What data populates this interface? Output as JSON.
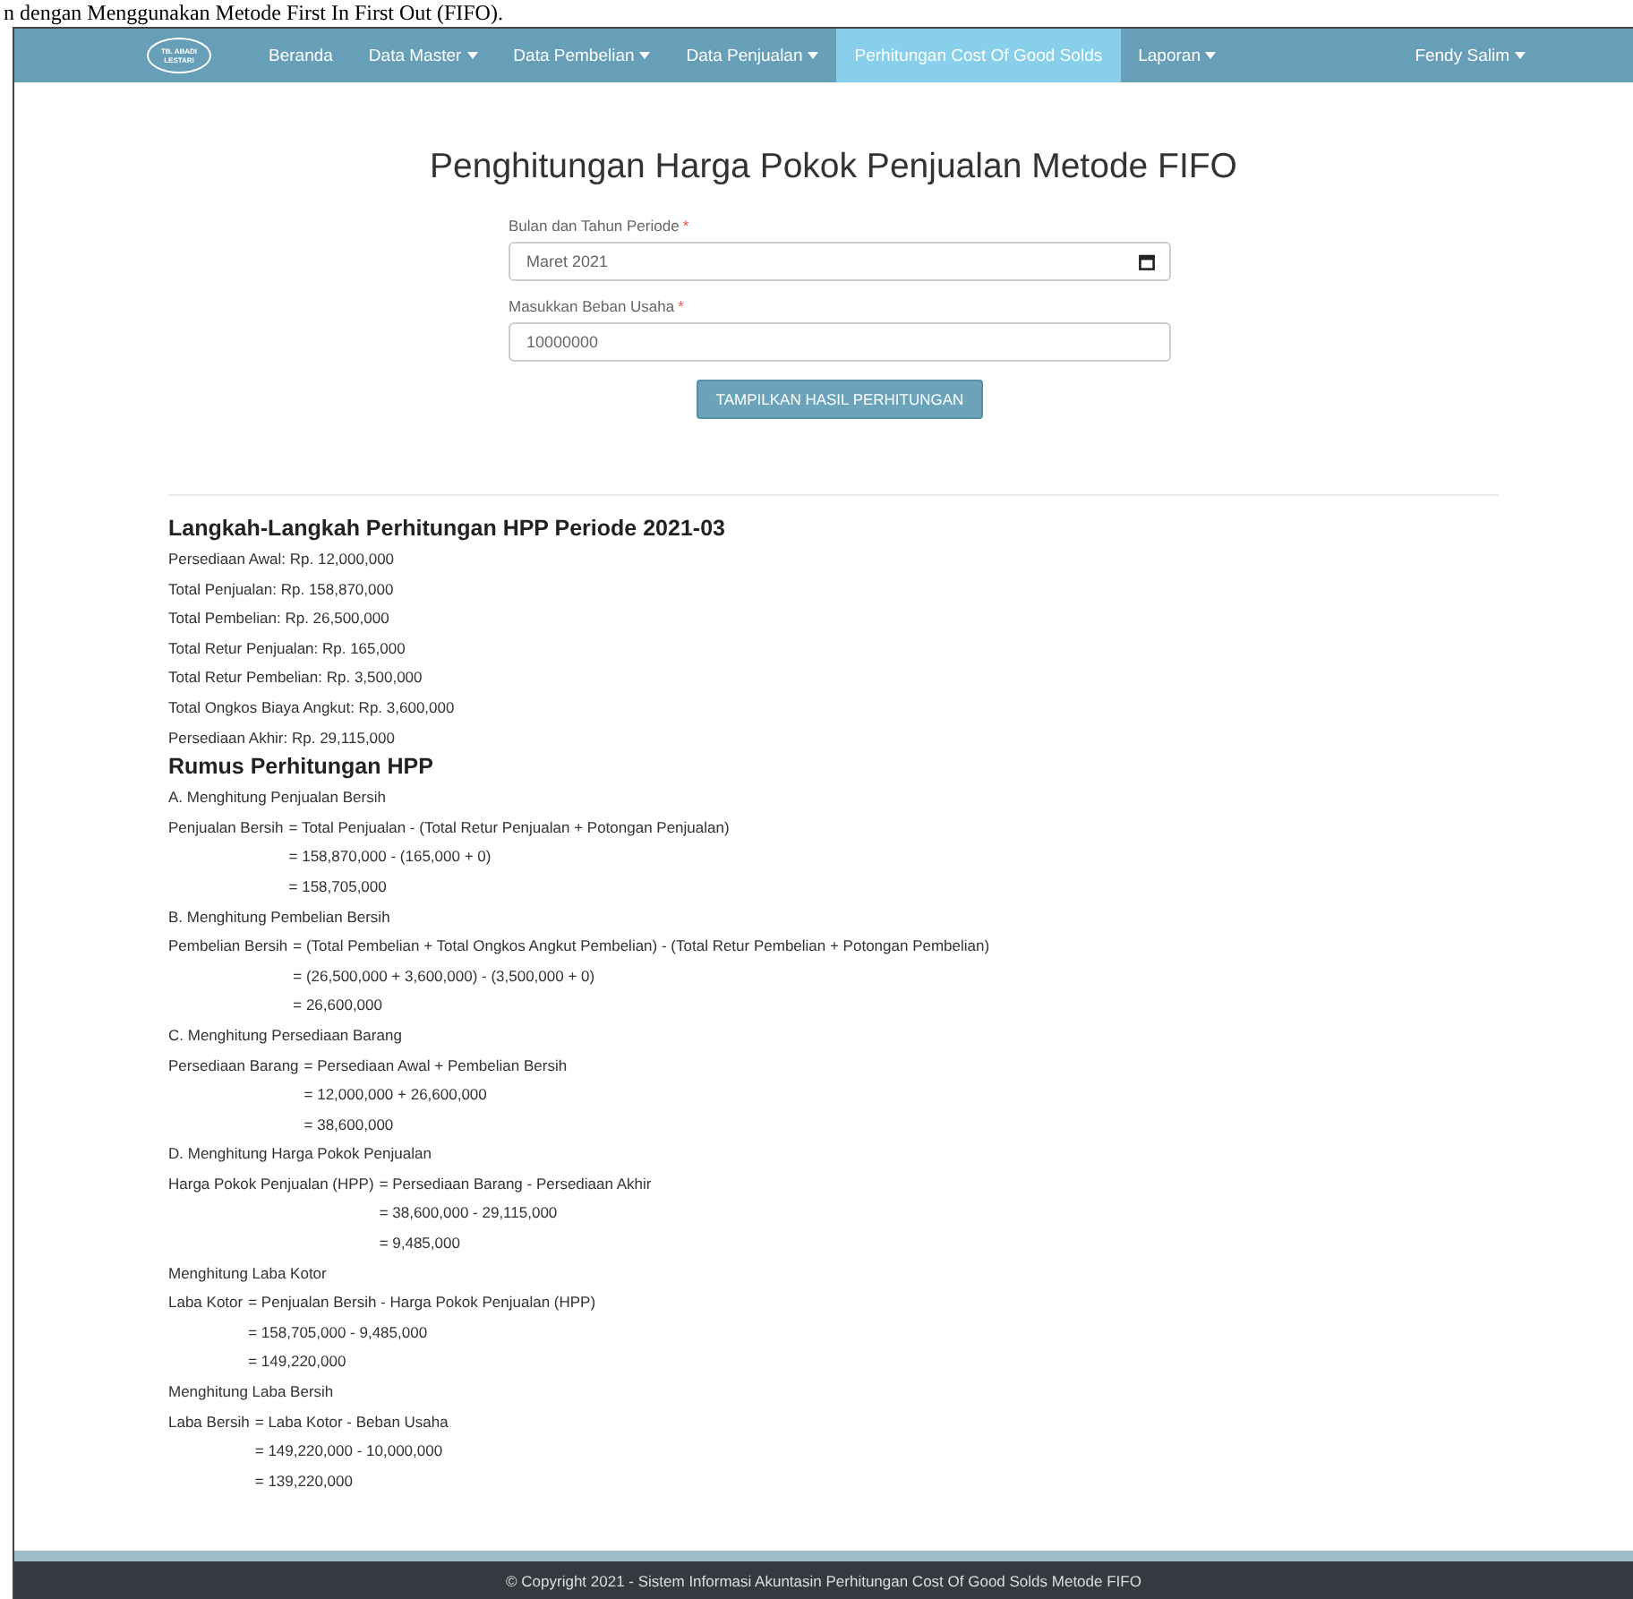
{
  "document_caption": "n dengan Menggunakan Metode First In First Out (FIFO).",
  "navbar": {
    "logo": [
      "TB. ABADI",
      "LESTARI"
    ],
    "items": [
      {
        "label": "Beranda",
        "dropdown": false,
        "selected": false
      },
      {
        "label": "Data Master",
        "dropdown": true,
        "selected": false
      },
      {
        "label": "Data Pembelian",
        "dropdown": true,
        "selected": false
      },
      {
        "label": "Data Penjualan",
        "dropdown": true,
        "selected": false
      },
      {
        "label": "Perhitungan Cost Of Good Solds",
        "dropdown": false,
        "selected": true
      },
      {
        "label": "Laporan",
        "dropdown": true,
        "selected": false
      }
    ],
    "user": {
      "label": "Fendy Salim",
      "dropdown": true
    }
  },
  "form": {
    "title": "Penghitungan Harga Pokok Penjualan Metode FIFO",
    "fields": [
      {
        "label": "Bulan dan Tahun Periode",
        "required_mark": "*",
        "kind": "month",
        "value": "Maret 2021"
      },
      {
        "label": "Masukkan Beban Usaha",
        "required_mark": "*",
        "kind": "text",
        "value": "10000000"
      }
    ],
    "button": "TAMPILKAN HASIL PERHITUNGAN"
  },
  "summary": {
    "title": "Langkah-Langkah Perhitungan HPP Periode 2021-03",
    "items": [
      "Persediaan Awal: Rp. 12,000,000",
      "Total Penjualan: Rp. 158,870,000",
      "Total Pembelian: Rp. 26,500,000",
      "Total Retur Penjualan: Rp. 165,000",
      "Total Retur Pembelian: Rp. 3,500,000",
      "Total Ongkos Biaya Angkut: Rp. 3,600,000",
      "Persediaan Akhir: Rp. 29,115,000"
    ]
  },
  "formulas": {
    "title": "Rumus Perhitungan HPP",
    "sections": [
      {
        "heading": "A. Menghitung Penjualan Bersih",
        "lhs": "Penjualan Bersih",
        "lines": [
          "= Total Penjualan - (Total Retur Penjualan + Potongan Penjualan)",
          "= 158,870,000 - (165,000 + 0)",
          "= 158,705,000"
        ]
      },
      {
        "heading": "B. Menghitung Pembelian Bersih",
        "lhs": "Pembelian Bersih",
        "lines": [
          "= (Total Pembelian + Total Ongkos Angkut Pembelian) - (Total Retur Pembelian + Potongan Pembelian)",
          "= (26,500,000 + 3,600,000) - (3,500,000 + 0)",
          "= 26,600,000"
        ]
      },
      {
        "heading": "C. Menghitung Persediaan Barang",
        "lhs": "Persediaan Barang",
        "lines": [
          "= Persediaan Awal + Pembelian Bersih",
          "= 12,000,000 + 26,600,000",
          "= 38,600,000"
        ]
      },
      {
        "heading": "D. Menghitung Harga Pokok Penjualan",
        "lhs": "Harga Pokok Penjualan (HPP)",
        "lines": [
          "= Persediaan Barang - Persediaan Akhir",
          "= 38,600,000 - 29,115,000",
          "= 9,485,000"
        ]
      },
      {
        "heading": "Menghitung Laba Kotor",
        "lhs": "Laba Kotor",
        "lines": [
          "= Penjualan Bersih - Harga Pokok Penjualan (HPP)",
          "= 158,705,000 - 9,485,000",
          "= 149,220,000"
        ]
      },
      {
        "heading": "Menghitung Laba Bersih",
        "lhs": "Laba Bersih",
        "lines": [
          "= Laba Kotor - Beban Usaha",
          "= 149,220,000 - 10,000,000",
          "= 139,220,000"
        ]
      }
    ]
  },
  "footer": "© Copyright 2021 - Sistem Informasi Akuntasin Perhitungan Cost Of Good Solds Metode FIFO"
}
